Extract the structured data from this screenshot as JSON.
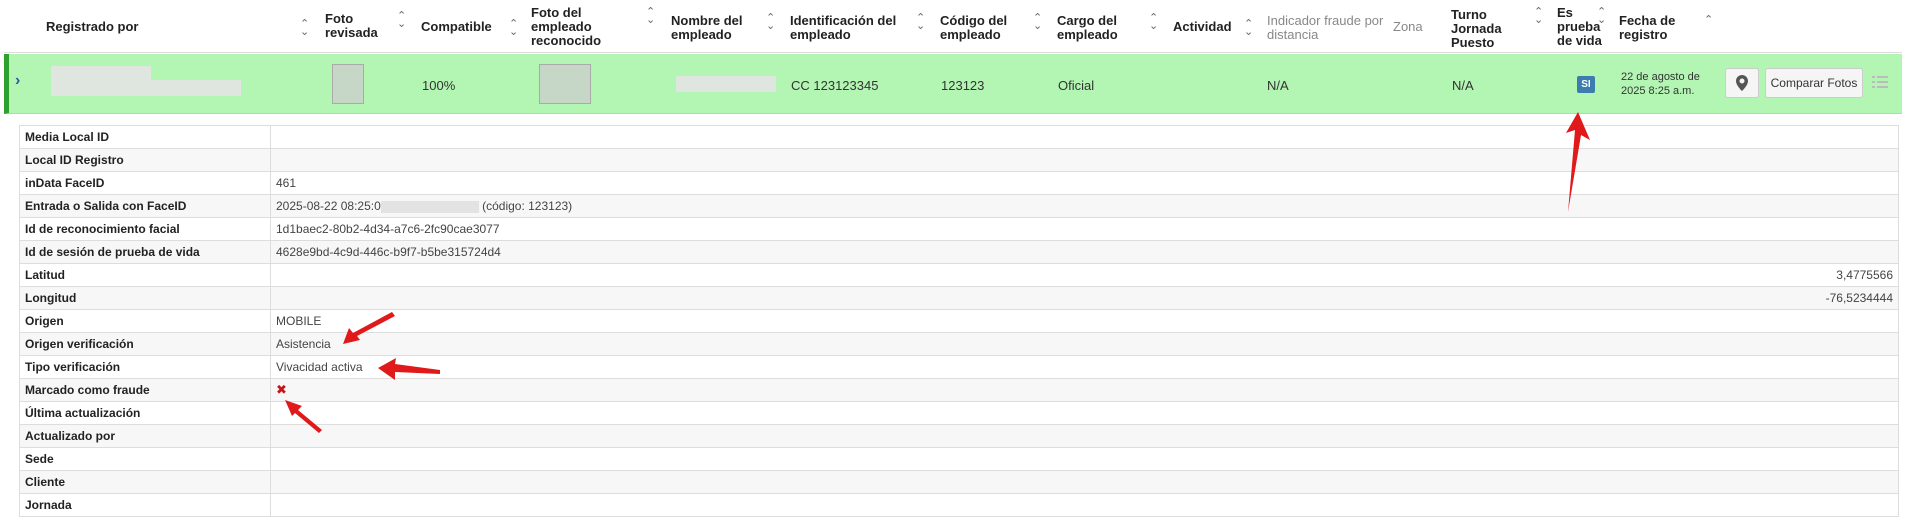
{
  "header": {
    "registrado_por": "Registrado por",
    "foto_revisada": "Foto revisada",
    "compatible": "Compatible",
    "foto_reconocido": "Foto del empleado reconocido",
    "nombre": "Nombre del empleado",
    "identificacion": "Identificación del empleado",
    "codigo": "Código del empleado",
    "cargo": "Cargo del empleado",
    "actividad": "Actividad",
    "indicador": "Indicador fraude por distancia",
    "zona": "Zona",
    "turno": "Turno Jornada Puesto",
    "prueba": "Es prueba de vida",
    "fecha": "Fecha de registro"
  },
  "row": {
    "compatible": "100%",
    "identificacion": "CC 123123345",
    "codigo": "123123",
    "cargo": "Oficial",
    "indicador": "N/A",
    "turno": "N/A",
    "prueba": "SI",
    "fecha": "22 de agosto de 2025 8:25 a.m.",
    "comparar": "Comparar Fotos"
  },
  "detail": [
    {
      "label": "Media Local ID",
      "value": ""
    },
    {
      "label": "Local ID Registro",
      "value": ""
    },
    {
      "label": "inData FaceID",
      "value": "461"
    },
    {
      "label": "Entrada o Salida con FaceID",
      "value": "2025-08-22 08:25:0",
      "value2": "(código: 123123)"
    },
    {
      "label": "Id de reconocimiento facial",
      "value": "1d1baec2-80b2-4d34-a7c6-2fc90cae3077"
    },
    {
      "label": "Id de sesión de prueba de vida",
      "value": "4628e9bd-4c9d-446c-b9f7-b5be315724d4"
    },
    {
      "label": "Latitud",
      "value": "3,4775566"
    },
    {
      "label": "Longitud",
      "value": "-76,5234444"
    },
    {
      "label": "Origen",
      "value": "MOBILE"
    },
    {
      "label": "Origen verificación",
      "value": "Asistencia"
    },
    {
      "label": "Tipo verificación",
      "value": "Vivacidad activa"
    },
    {
      "label": "Marcado como fraude",
      "value": "✖"
    },
    {
      "label": "Última actualización",
      "value": ""
    },
    {
      "label": "Actualizado por",
      "value": ""
    },
    {
      "label": "Sede",
      "value": ""
    },
    {
      "label": "Cliente",
      "value": ""
    },
    {
      "label": "Jornada",
      "value": ""
    }
  ],
  "icons": {
    "sort": "sort-icon",
    "expand": "chevron-right-icon",
    "location": "map-pin-icon",
    "list": "list-icon",
    "annotation": "red-arrow-icon"
  },
  "colors": {
    "row_bg": "#b3f5b3",
    "row_accent": "#2ea02e",
    "badge": "#3c7cae",
    "arrow": "#e0191b"
  }
}
